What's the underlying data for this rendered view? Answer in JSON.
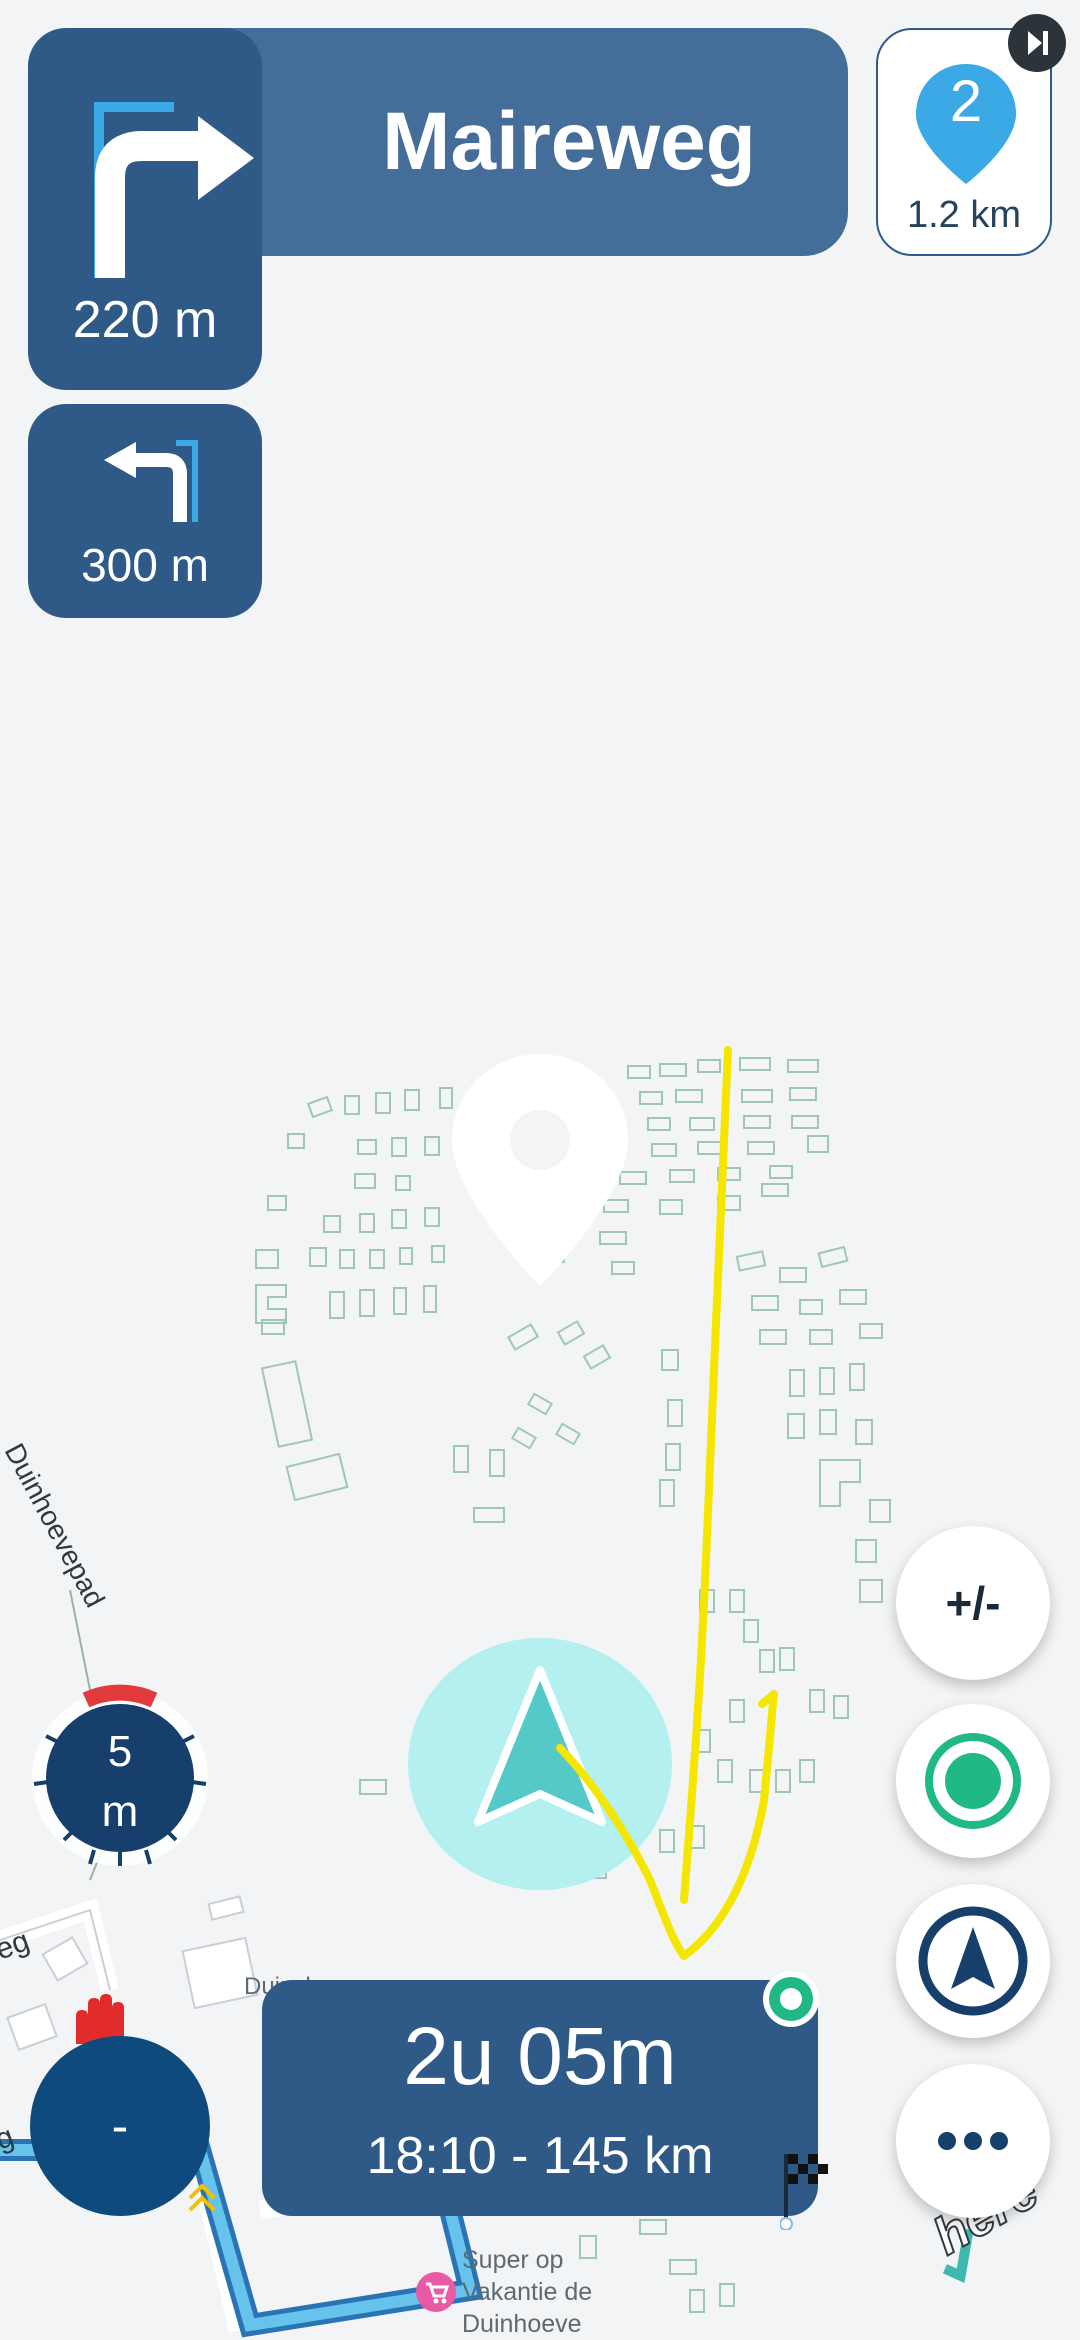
{
  "maneuver": {
    "street": "Maireweg",
    "distance": "220 m",
    "turn_icon": "turn-right-arrow"
  },
  "next_maneuver": {
    "distance": "300 m",
    "turn_icon": "turn-left-arrow"
  },
  "waypoint": {
    "number": "2",
    "distance": "1.2 km",
    "icon": "location-pin"
  },
  "speed": {
    "value": "5",
    "unit": "m"
  },
  "stop_button": {
    "label": "-"
  },
  "eta": {
    "duration": "2u 05m",
    "arrival_and_distance": "18:10 - 145 km"
  },
  "controls": {
    "zoom_label": "+/-"
  },
  "map_labels": {
    "street_1": "Duinhoevepad",
    "street_2": "eg",
    "street_3": "g",
    "poi_1": "Duinshop",
    "poi_2_line1": "Super op",
    "poi_2_line2": "Vakantie de",
    "poi_2_line3": "Duinhoeve"
  },
  "brand": {
    "logo_text": "here"
  },
  "colors": {
    "panel": "#446e99",
    "panel_dark": "#2f5a88",
    "accent_blue": "#3ba9e6",
    "position_cyan": "#4fcfcf",
    "green": "#21b887",
    "annotation_yellow": "#f5e600"
  }
}
